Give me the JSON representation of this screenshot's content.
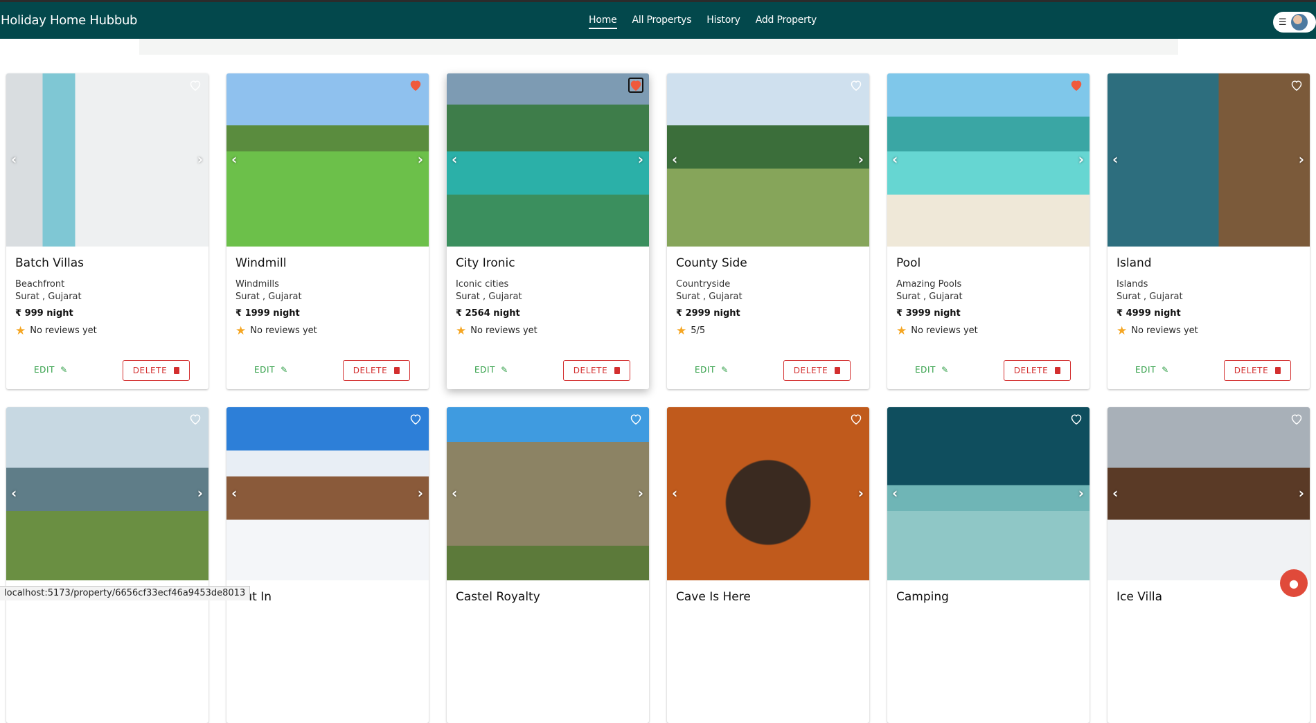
{
  "app": {
    "title": "Holiday Home Hubbub"
  },
  "nav": {
    "items": [
      {
        "label": "Home",
        "active": true
      },
      {
        "label": "All Propertys",
        "active": false
      },
      {
        "label": "History",
        "active": false
      },
      {
        "label": "Add Property",
        "active": false
      }
    ]
  },
  "user_menu": {
    "menu_icon": "hamburger-icon",
    "avatar_icon": "user-avatar"
  },
  "labels": {
    "edit": "EDIT",
    "delete": "DELETE"
  },
  "properties": [
    {
      "title": "Batch Villas",
      "category": "Beachfront",
      "location": "Surat , Gujarat",
      "price": "₹ 999 night",
      "rating": "No reviews yet",
      "favorited": false
    },
    {
      "title": "Windmill",
      "category": "Windmills",
      "location": "Surat , Gujarat",
      "price": "₹ 1999 night",
      "rating": "No reviews yet",
      "favorited": true
    },
    {
      "title": "City Ironic",
      "category": "Iconic cities",
      "location": "Surat , Gujarat",
      "price": "₹ 2564 night",
      "rating": "No reviews yet",
      "favorited": true
    },
    {
      "title": "County Side",
      "category": "Countryside",
      "location": "Surat , Gujarat",
      "price": "₹ 2999 night",
      "rating": "5/5",
      "favorited": false
    },
    {
      "title": "Pool",
      "category": "Amazing Pools",
      "location": "Surat , Gujarat",
      "price": "₹ 3999 night",
      "rating": "No reviews yet",
      "favorited": true
    },
    {
      "title": "Island",
      "category": "Islands",
      "location": "Surat , Gujarat",
      "price": "₹ 4999 night",
      "rating": "No reviews yet",
      "favorited": false
    },
    {
      "title": "",
      "favorited": false
    },
    {
      "title": "Out In",
      "favorited": false
    },
    {
      "title": "Castel Royalty",
      "favorited": false
    },
    {
      "title": "Cave Is Here",
      "favorited": false
    },
    {
      "title": "Camping",
      "favorited": false
    },
    {
      "title": "Ice Villa",
      "favorited": false
    }
  ],
  "status_bar": {
    "url": "localhost:5173/property/6656cf33ecf46a9453de8013"
  },
  "colors": {
    "topbar": "#03484c",
    "edit": "#2e9e45",
    "delete": "#d32f2f",
    "favorite": "#f05a3c"
  }
}
